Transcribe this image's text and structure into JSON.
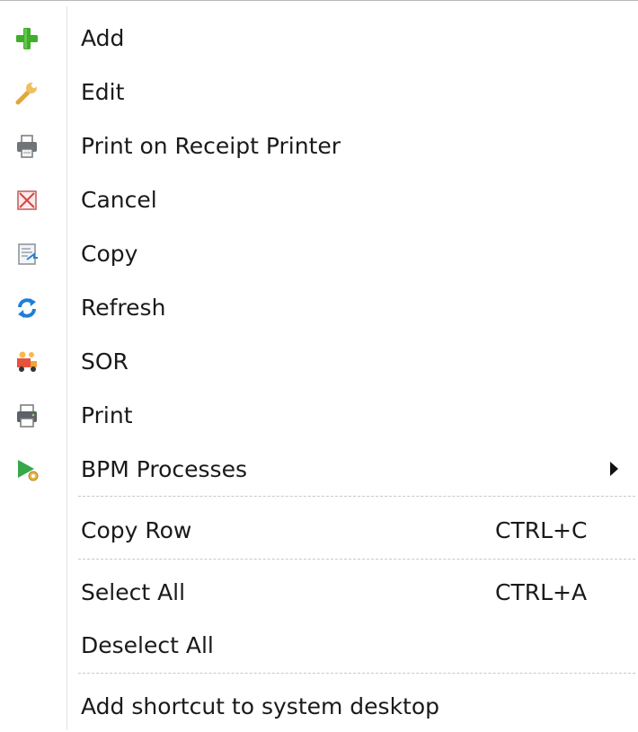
{
  "menu": {
    "items": {
      "add": {
        "label": "Add",
        "icon": "add-icon"
      },
      "edit": {
        "label": "Edit",
        "icon": "wrench-icon"
      },
      "print_receipt": {
        "label": "Print on Receipt Printer",
        "icon": "receipt-printer-icon"
      },
      "cancel": {
        "label": "Cancel",
        "icon": "cancel-icon"
      },
      "copy": {
        "label": "Copy",
        "icon": "copy-document-icon"
      },
      "refresh": {
        "label": "Refresh",
        "icon": "refresh-icon"
      },
      "sor": {
        "label": "SOR",
        "icon": "sor-truck-icon"
      },
      "print": {
        "label": "Print",
        "icon": "printer-icon"
      },
      "bpm": {
        "label": "BPM Processes",
        "icon": "bpm-play-gear-icon",
        "has_submenu": true
      },
      "copy_row": {
        "label": "Copy Row",
        "shortcut": "CTRL+C"
      },
      "select_all": {
        "label": "Select All",
        "shortcut": "CTRL+A"
      },
      "deselect_all": {
        "label": "Deselect All"
      },
      "add_shortcut": {
        "label": "Add shortcut to system desktop"
      }
    }
  },
  "colors": {
    "add_green": "#3fae29",
    "refresh_blue": "#1f7fd6",
    "cancel_red": "#d64545",
    "bpm_green": "#36a84a",
    "separator": "#c8c8c8"
  }
}
